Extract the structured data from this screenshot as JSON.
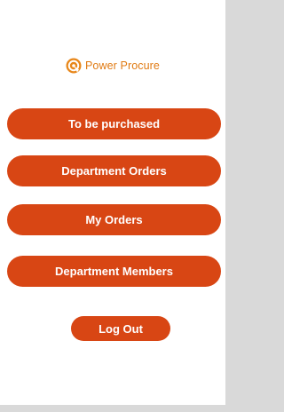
{
  "brand": {
    "name": "Power Procure",
    "logo_icon": "power-procure-logo-icon",
    "accent_color": "#e07a12"
  },
  "menu": {
    "button_color": "#d84614",
    "items": [
      {
        "label": "To be purchased"
      },
      {
        "label": "Department Orders"
      },
      {
        "label": "My Orders"
      },
      {
        "label": "Department Members"
      }
    ]
  },
  "logout": {
    "label": "Log Out"
  }
}
